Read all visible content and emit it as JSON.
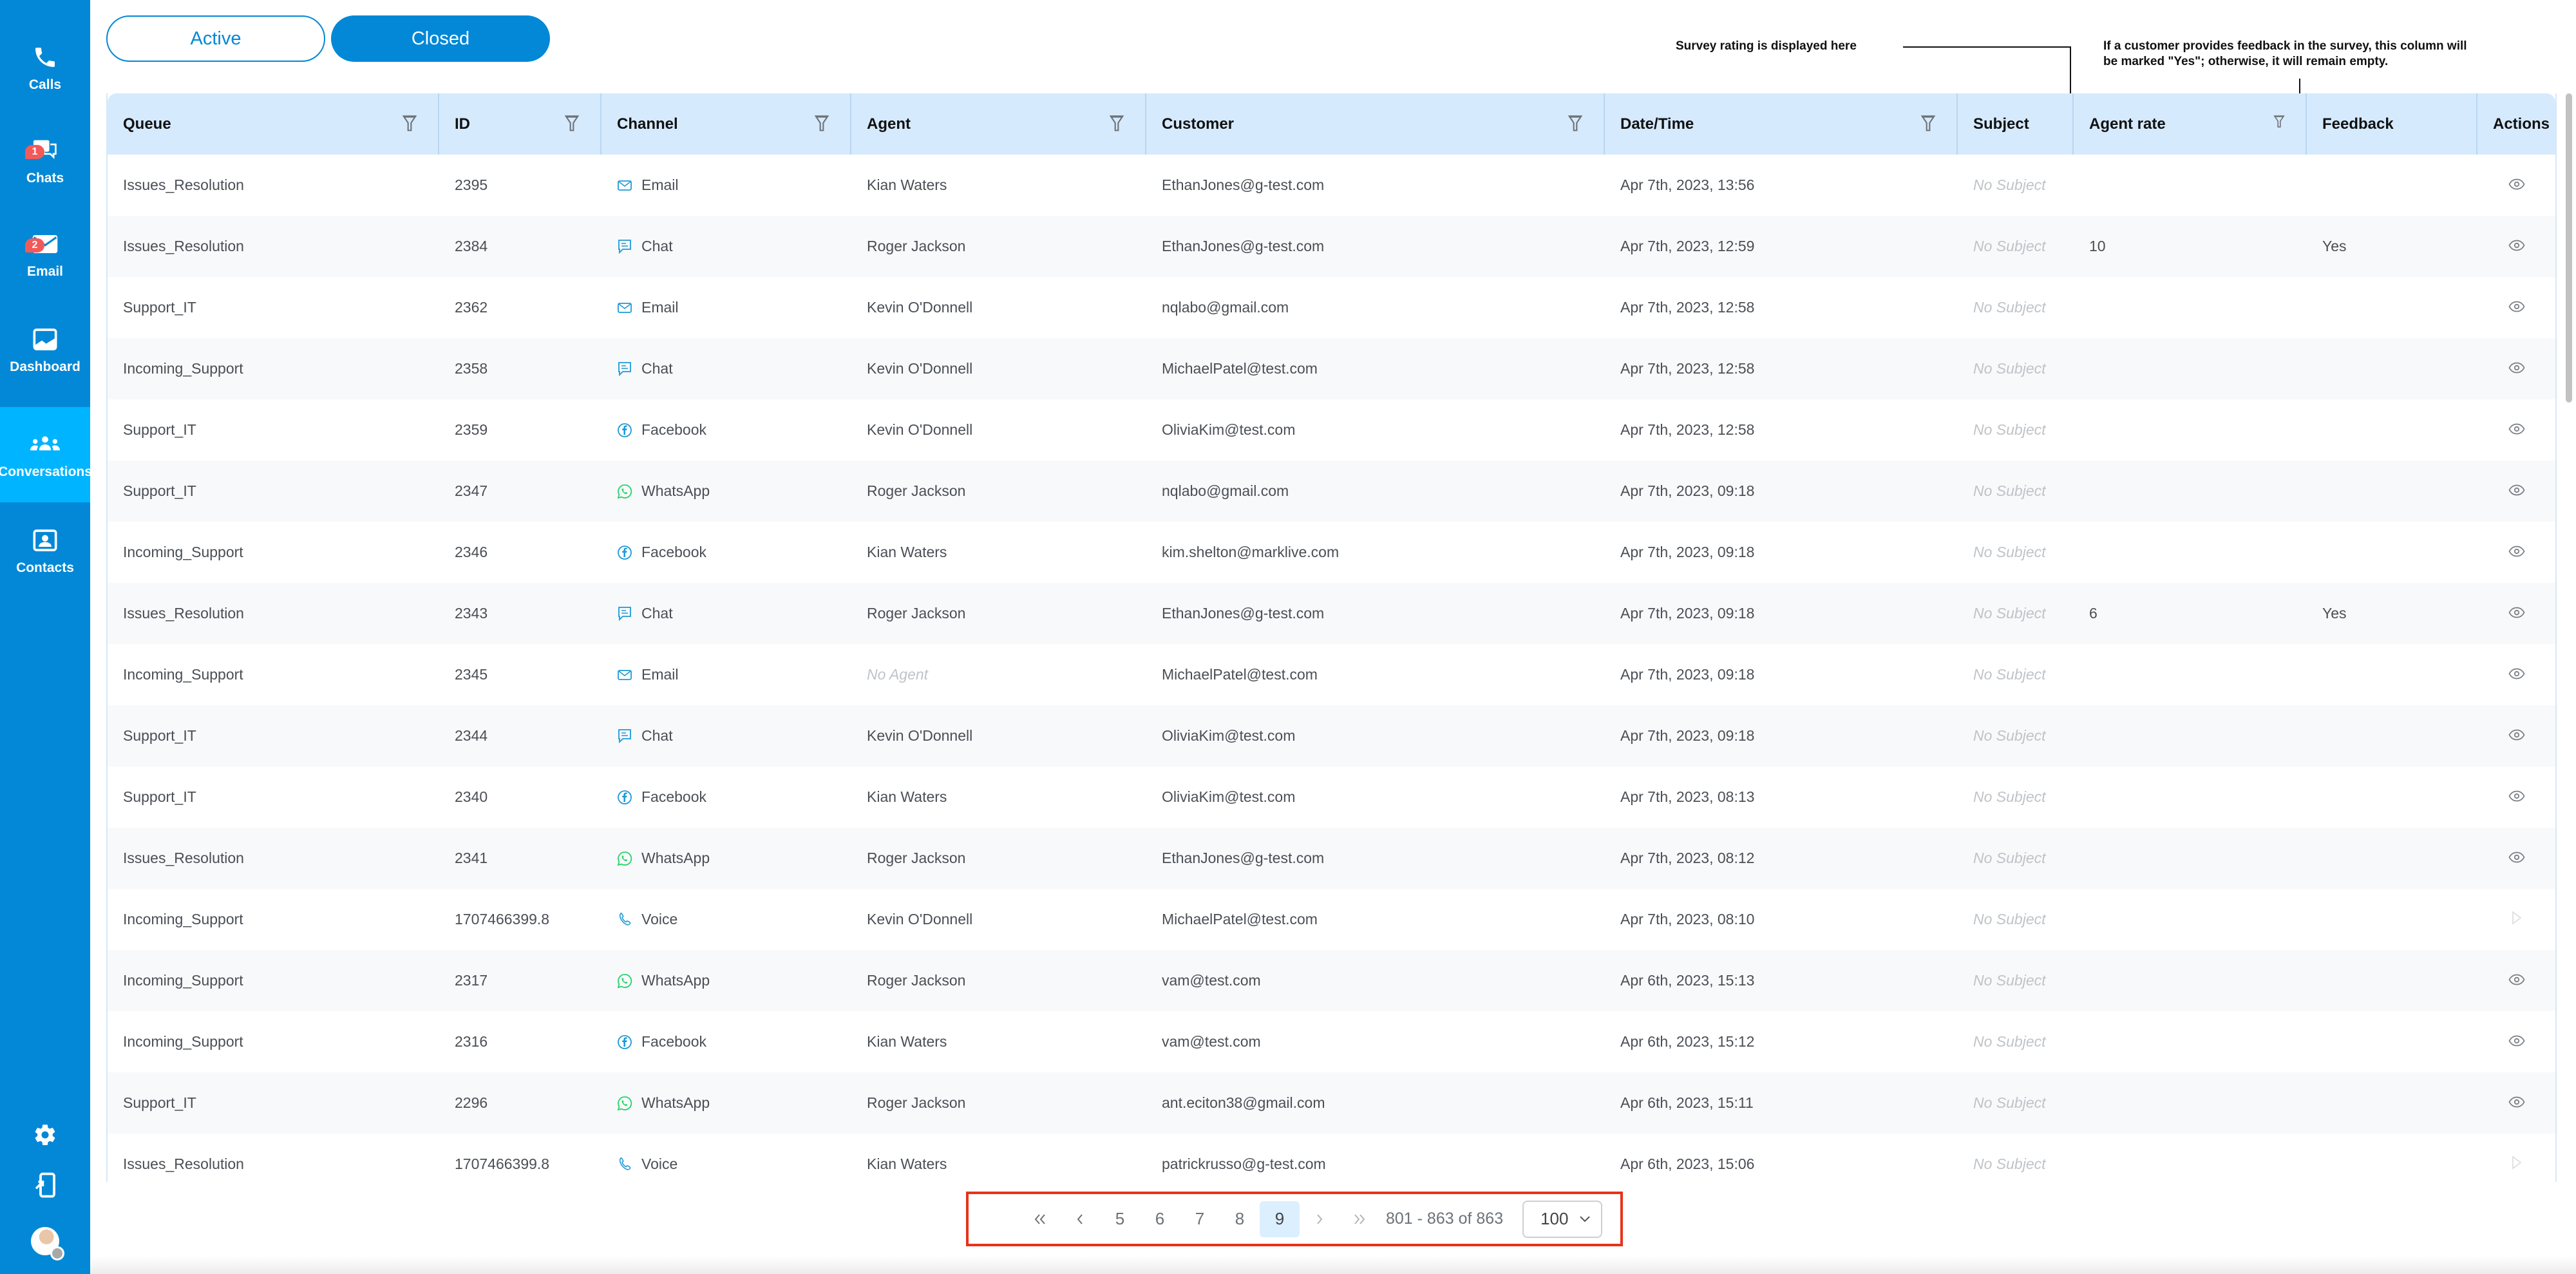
{
  "sidebar": {
    "items": [
      {
        "label": "Calls",
        "icon": "phone-icon"
      },
      {
        "label": "Chats",
        "icon": "chat-bubbles-icon",
        "badge": "1"
      },
      {
        "label": "Email",
        "icon": "envelope-icon",
        "badge": "2"
      },
      {
        "label": "Dashboard",
        "icon": "chart-icon"
      },
      {
        "label": "Conversations",
        "icon": "group-icon",
        "active": true
      },
      {
        "label": "Contacts",
        "icon": "contact-card-icon"
      }
    ],
    "bottom": [
      "gear-icon",
      "logout-device-icon",
      "avatar"
    ]
  },
  "toggles": {
    "active_label": "Active",
    "closed_label": "Closed",
    "selected": "Closed"
  },
  "annotations": {
    "rating": "Survey rating is displayed here",
    "feedback_line1": "If a customer provides feedback in the survey, this column will",
    "feedback_line2": "be marked \"Yes\"; otherwise, it will remain empty."
  },
  "table": {
    "columns": [
      "Queue",
      "ID",
      "Channel",
      "Agent",
      "Customer",
      "Date/Time",
      "Subject",
      "Agent rate",
      "Feedback",
      "Actions"
    ],
    "rows": [
      {
        "queue": "Issues_Resolution",
        "id": "2395",
        "channel": "Email",
        "agent": "Kian Waters",
        "customer": "EthanJones@g-test.com",
        "datetime": "Apr 7th, 2023, 13:56",
        "subject": "No Subject",
        "rate": "",
        "feedback": "",
        "action": "view"
      },
      {
        "queue": "Issues_Resolution",
        "id": "2384",
        "channel": "Chat",
        "agent": "Roger Jackson",
        "customer": "EthanJones@g-test.com",
        "datetime": "Apr 7th, 2023, 12:59",
        "subject": "No Subject",
        "rate": "10",
        "feedback": "Yes",
        "action": "view"
      },
      {
        "queue": "Support_IT",
        "id": "2362",
        "channel": "Email",
        "agent": "Kevin O'Donnell",
        "customer": "nqlabo@gmail.com",
        "datetime": "Apr 7th, 2023, 12:58",
        "subject": "No Subject",
        "rate": "",
        "feedback": "",
        "action": "view"
      },
      {
        "queue": "Incoming_Support",
        "id": "2358",
        "channel": "Chat",
        "agent": "Kevin O'Donnell",
        "customer": "MichaelPatel@test.com",
        "datetime": "Apr 7th, 2023, 12:58",
        "subject": "No Subject",
        "rate": "",
        "feedback": "",
        "action": "view"
      },
      {
        "queue": "Support_IT",
        "id": "2359",
        "channel": "Facebook",
        "agent": "Kevin O'Donnell",
        "customer": "OliviaKim@test.com",
        "datetime": "Apr 7th, 2023, 12:58",
        "subject": "No Subject",
        "rate": "",
        "feedback": "",
        "action": "view"
      },
      {
        "queue": "Support_IT",
        "id": "2347",
        "channel": "WhatsApp",
        "agent": "Roger Jackson",
        "customer": "nqlabo@gmail.com",
        "datetime": "Apr 7th, 2023, 09:18",
        "subject": "No Subject",
        "rate": "",
        "feedback": "",
        "action": "view"
      },
      {
        "queue": "Incoming_Support",
        "id": "2346",
        "channel": "Facebook",
        "agent": "Kian Waters",
        "customer": "kim.shelton@marklive.com",
        "datetime": "Apr 7th, 2023, 09:18",
        "subject": "No Subject",
        "rate": "",
        "feedback": "",
        "action": "view"
      },
      {
        "queue": "Issues_Resolution",
        "id": "2343",
        "channel": "Chat",
        "agent": "Roger Jackson",
        "customer": "EthanJones@g-test.com",
        "datetime": "Apr 7th, 2023, 09:18",
        "subject": "No Subject",
        "rate": "6",
        "feedback": "Yes",
        "action": "view"
      },
      {
        "queue": "Incoming_Support",
        "id": "2345",
        "channel": "Email",
        "agent": "No Agent",
        "agent_muted": true,
        "customer": "MichaelPatel@test.com",
        "datetime": "Apr 7th, 2023, 09:18",
        "subject": "No Subject",
        "rate": "",
        "feedback": "",
        "action": "view"
      },
      {
        "queue": "Support_IT",
        "id": "2344",
        "channel": "Chat",
        "agent": "Kevin O'Donnell",
        "customer": "OliviaKim@test.com",
        "datetime": "Apr 7th, 2023, 09:18",
        "subject": "No Subject",
        "rate": "",
        "feedback": "",
        "action": "view"
      },
      {
        "queue": "Support_IT",
        "id": "2340",
        "channel": "Facebook",
        "agent": "Kian Waters",
        "customer": "OliviaKim@test.com",
        "datetime": "Apr 7th, 2023, 08:13",
        "subject": "No Subject",
        "rate": "",
        "feedback": "",
        "action": "view"
      },
      {
        "queue": "Issues_Resolution",
        "id": "2341",
        "channel": "WhatsApp",
        "agent": "Roger Jackson",
        "customer": "EthanJones@g-test.com",
        "datetime": "Apr 7th, 2023, 08:12",
        "subject": "No Subject",
        "rate": "",
        "feedback": "",
        "action": "view"
      },
      {
        "queue": "Incoming_Support",
        "id": "1707466399.8",
        "channel": "Voice",
        "agent": "Kevin O'Donnell",
        "customer": "MichaelPatel@test.com",
        "datetime": "Apr 7th, 2023, 08:10",
        "subject": "No Subject",
        "rate": "",
        "feedback": "",
        "action": "play"
      },
      {
        "queue": "Incoming_Support",
        "id": "2317",
        "channel": "WhatsApp",
        "agent": "Roger Jackson",
        "customer": "vam@test.com",
        "datetime": "Apr 6th, 2023, 15:13",
        "subject": "No Subject",
        "rate": "",
        "feedback": "",
        "action": "view"
      },
      {
        "queue": "Incoming_Support",
        "id": "2316",
        "channel": "Facebook",
        "agent": "Kian Waters",
        "customer": "vam@test.com",
        "datetime": "Apr 6th, 2023, 15:12",
        "subject": "No Subject",
        "rate": "",
        "feedback": "",
        "action": "view"
      },
      {
        "queue": "Support_IT",
        "id": "2296",
        "channel": "WhatsApp",
        "agent": "Roger Jackson",
        "customer": "ant.eciton38@gmail.com",
        "datetime": "Apr 6th, 2023, 15:11",
        "subject": "No Subject",
        "rate": "",
        "feedback": "",
        "action": "view"
      },
      {
        "queue": "Issues_Resolution",
        "id": "1707466399.8",
        "channel": "Voice",
        "agent": "Kian Waters",
        "customer": "patrickrusso@g-test.com",
        "datetime": "Apr 6th, 2023, 15:06",
        "subject": "No Subject",
        "rate": "",
        "feedback": "",
        "action": "play"
      }
    ]
  },
  "pagination": {
    "first": "«",
    "prev": "‹",
    "pages": [
      "5",
      "6",
      "7",
      "8",
      "9"
    ],
    "current": "9",
    "next": "›",
    "last": "»",
    "range": "801 - 863 of 863",
    "page_size": "100"
  },
  "colors": {
    "brand": "#0288d6",
    "active_nav": "#00b4ff",
    "header_bg": "#d6eafd",
    "badge": "#f25a5a",
    "highlight_border": "#e8321a",
    "whatsapp": "#25d366"
  }
}
